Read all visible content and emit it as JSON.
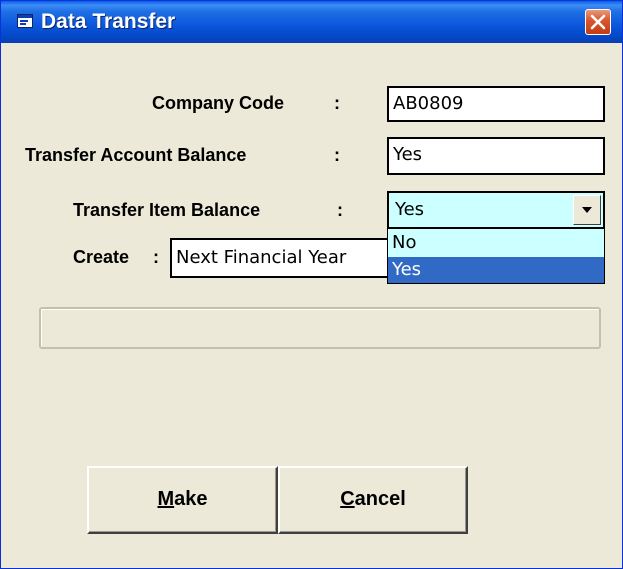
{
  "window": {
    "title": "Data Transfer",
    "title_icon": "app-window-icon",
    "close_icon": "close-icon"
  },
  "form": {
    "company_code": {
      "label": "Company Code",
      "colon": ":",
      "value": "AB0809"
    },
    "transfer_account_balance": {
      "label": "Transfer Account Balance",
      "colon": ":",
      "value": "Yes"
    },
    "transfer_item_balance": {
      "label": "Transfer Item Balance",
      "colon": ":",
      "value": "Yes",
      "options": [
        "No",
        "Yes"
      ],
      "selected_option": "Yes",
      "dropdown_open": true
    },
    "create": {
      "label": "Create",
      "colon": ":",
      "value": "Next Financial Year"
    }
  },
  "progress": {
    "value": 0
  },
  "buttons": {
    "make": {
      "mnemonic": "M",
      "rest": "ake"
    },
    "cancel": {
      "mnemonic": "C",
      "rest": "ancel"
    }
  },
  "colors": {
    "titlebar": "#0a55dc",
    "window_bg": "#ece9d8",
    "combo_bg": "#ccffff",
    "selection": "#316ac5",
    "close_button": "#d9542c"
  }
}
